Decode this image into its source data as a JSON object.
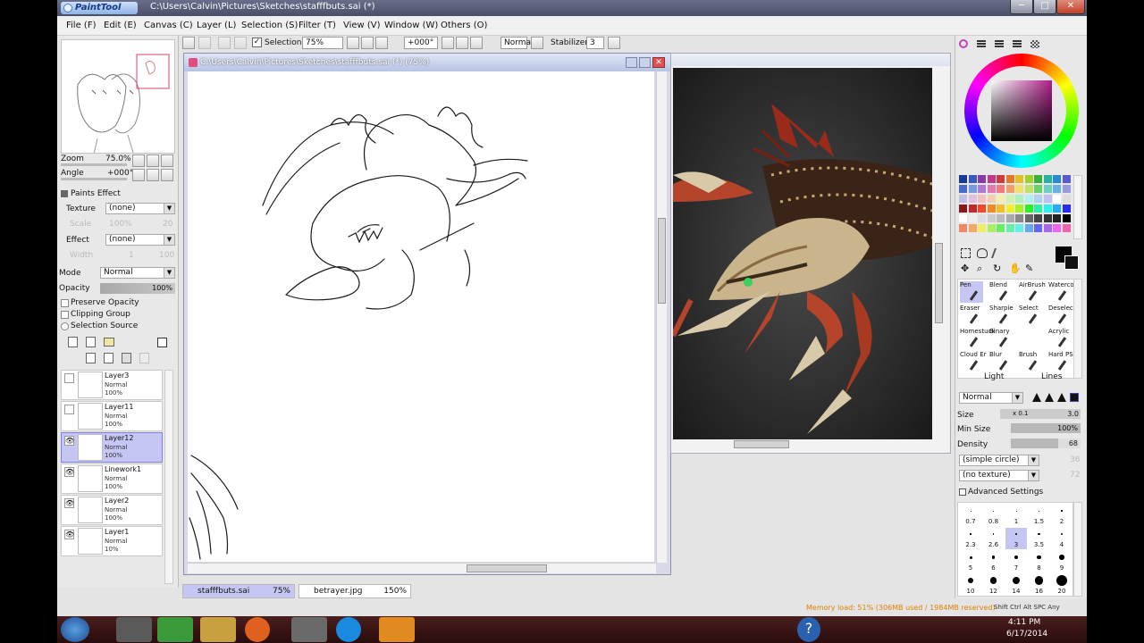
{
  "app": {
    "logo_text": "PaintTool SAI",
    "window_title": "C:\\Users\\Calvin\\Pictures\\Sketches\\stafffbuts.sai (*)",
    "minimize": "─",
    "maximize": "□",
    "close": "✕"
  },
  "menu": [
    "File (F)",
    "Edit (E)",
    "Canvas (C)",
    "Layer (L)",
    "Selection (S)",
    "Filter (T)",
    "View (V)",
    "Window (W)",
    "Others (O)"
  ],
  "toolbar": {
    "selection_label": "Selection",
    "zoom_value": "75%",
    "angle_value": "+000°",
    "blend_mode": "Normal",
    "stabilizer_label": "Stabilizer",
    "stabilizer_value": "3"
  },
  "navigator": {
    "zoom_label": "Zoom",
    "zoom_value": "75.0%",
    "angle_label": "Angle",
    "angle_value": "+000°"
  },
  "paints_effect": {
    "title": "Paints Effect",
    "texture_label": "Texture",
    "texture_value": "(none)",
    "scale_label": "Scale",
    "scale_value": "100%",
    "scale_num": "20",
    "effect_label": "Effect",
    "effect_value": "(none)",
    "width_label": "Width",
    "width_value": "1",
    "width_num": "100"
  },
  "layer_props": {
    "mode_label": "Mode",
    "mode_value": "Normal",
    "opacity_label": "Opacity",
    "opacity_value": "100%",
    "preserve_opacity": "Preserve Opacity",
    "clipping_group": "Clipping Group",
    "selection_source": "Selection Source"
  },
  "layers": [
    {
      "name": "Layer3",
      "mode": "Normal",
      "opacity": "100%",
      "visible": false,
      "active": false
    },
    {
      "name": "Layer11",
      "mode": "Normal",
      "opacity": "100%",
      "visible": false,
      "active": false
    },
    {
      "name": "Layer12",
      "mode": "Normal",
      "opacity": "100%",
      "visible": true,
      "active": true
    },
    {
      "name": "Linework1",
      "mode": "Normal",
      "opacity": "100%",
      "visible": true,
      "active": false
    },
    {
      "name": "Layer2",
      "mode": "Normal",
      "opacity": "100%",
      "visible": true,
      "active": false
    },
    {
      "name": "Layer1",
      "mode": "Normal",
      "opacity": "10%",
      "visible": true,
      "active": false
    }
  ],
  "canvas_window": {
    "title": "C:\\Users\\Calvin\\Pictures\\Sketches\\stafffbuts.sai (*) (75%)"
  },
  "doc_tabs": [
    {
      "name": "stafffbuts.sai",
      "zoom": "75%"
    },
    {
      "name": "betrayer.jpg",
      "zoom": "150%"
    }
  ],
  "brush": {
    "tools": [
      "Pen",
      "Blend",
      "AirBrush",
      "Watercolor",
      "Eraser",
      "Sharpie",
      "Select",
      "Deselect",
      "Homestuck",
      "Binary",
      "",
      "Acrylic",
      "Cloud Er",
      "Blur",
      "Brush",
      "Hard PS"
    ],
    "group_left": "Light",
    "group_right": "Lines",
    "blend_mode": "Normal",
    "size_label": "Size",
    "size_mult": "x 0.1",
    "size_value": "3.0",
    "min_size_label": "Min Size",
    "min_size_value": "100%",
    "density_label": "Density",
    "density_value": "68",
    "shape": "(simple circle)",
    "shape_num": "36",
    "texture": "(no texture)",
    "texture_num": "72",
    "advanced": "Advanced Settings",
    "presets": [
      "0.7",
      "0.8",
      "1",
      "1.5",
      "2",
      "2.3",
      "2.6",
      "3",
      "3.5",
      "4",
      "5",
      "6",
      "7",
      "8",
      "9",
      "10",
      "12",
      "14",
      "16",
      "20"
    ]
  },
  "status": {
    "memory": "Memory load: 51% (306MB used / 1984MB reserved)",
    "keys": "Shift Ctrl Alt SPC Any"
  },
  "taskbar": {
    "time": "4:11 PM",
    "date": "6/17/2014"
  },
  "colors": {
    "title_bg": "#4a4e68",
    "active_layer": "#c6c6f4",
    "memory_text": "#e08000"
  }
}
